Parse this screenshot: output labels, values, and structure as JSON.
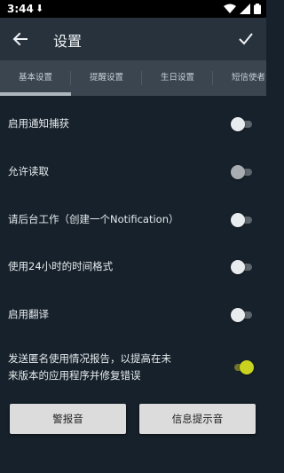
{
  "status_bar": {
    "time": "3:44",
    "notification_icon": "download-icon",
    "wifi_icon": "wifi-icon",
    "signal_icon": "signal-icon",
    "battery_icon": "battery-icon"
  },
  "app_bar": {
    "back_icon": "arrow-back-icon",
    "title": "设置",
    "confirm_icon": "check-icon"
  },
  "tabs": [
    {
      "label": "基本设置",
      "selected": true
    },
    {
      "label": "提醒设置",
      "selected": false
    },
    {
      "label": "生日设置",
      "selected": false
    },
    {
      "label": "短信使者",
      "selected": false
    }
  ],
  "settings": [
    {
      "label": "启用通知捕获",
      "checked": false,
      "enabled": true
    },
    {
      "label": "允许读取",
      "checked": false,
      "enabled": false
    },
    {
      "label": "请后台工作（创建一个Notification）",
      "checked": false,
      "enabled": true
    },
    {
      "label": "使用24小时的时间格式",
      "checked": false,
      "enabled": true
    },
    {
      "label": "启用翻译",
      "checked": false,
      "enabled": true
    },
    {
      "label_line1": "发送匿名使用情况报告，以提高在未",
      "label_line2": "来版本的应用程序并修复错误",
      "checked": true,
      "enabled": true
    }
  ],
  "buttons": {
    "alarm_sound": "警报音",
    "notification_sound": "信息提示音"
  },
  "colors": {
    "background": "#16212b",
    "app_bar": "#27323d",
    "tab_bar": "#3a4550",
    "switch_on": "#c9d21e"
  }
}
